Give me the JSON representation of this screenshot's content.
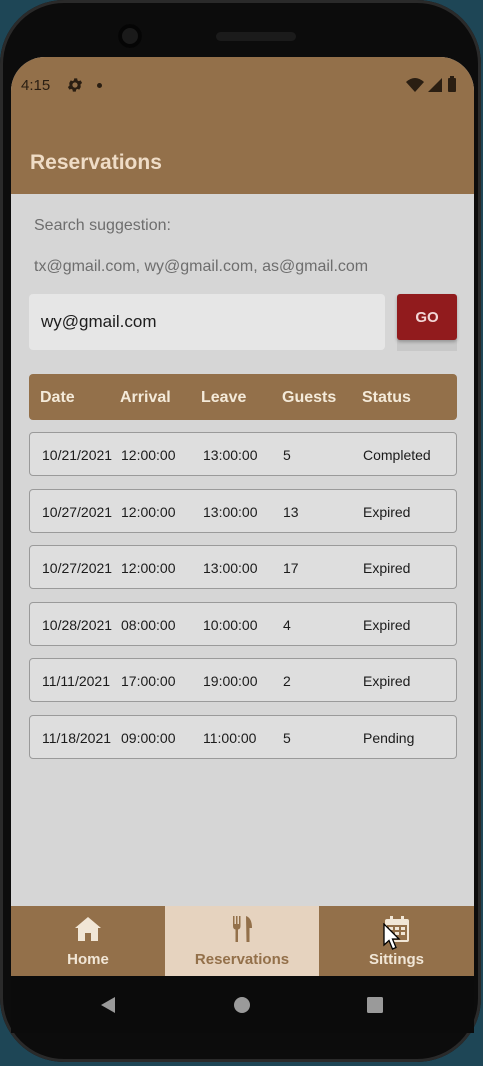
{
  "status_bar": {
    "time": "4:15"
  },
  "app": {
    "title": "Reservations"
  },
  "search": {
    "hint_label": "Search suggestion:",
    "hint_emails": "tx@gmail.com, wy@gmail.com, as@gmail.com",
    "value": "wy@gmail.com",
    "go_label": "GO"
  },
  "table": {
    "headers": {
      "date": "Date",
      "arrival": "Arrival",
      "leave": "Leave",
      "guests": "Guests",
      "status": "Status"
    },
    "rows": [
      {
        "date": "10/21/2021",
        "arrival": "12:00:00",
        "leave": "13:00:00",
        "guests": "5",
        "status": "Completed"
      },
      {
        "date": "10/27/2021",
        "arrival": "12:00:00",
        "leave": "13:00:00",
        "guests": "13",
        "status": "Expired"
      },
      {
        "date": "10/27/2021",
        "arrival": "12:00:00",
        "leave": "13:00:00",
        "guests": "17",
        "status": "Expired"
      },
      {
        "date": "10/28/2021",
        "arrival": "08:00:00",
        "leave": "10:00:00",
        "guests": "4",
        "status": "Expired"
      },
      {
        "date": "11/11/2021",
        "arrival": "17:00:00",
        "leave": "19:00:00",
        "guests": "2",
        "status": "Expired"
      },
      {
        "date": "11/18/2021",
        "arrival": "09:00:00",
        "leave": "11:00:00",
        "guests": "5",
        "status": "Pending"
      }
    ]
  },
  "nav": {
    "items": [
      {
        "label": "Home",
        "icon": "home-icon"
      },
      {
        "label": "Reservations",
        "icon": "fork-knife-icon"
      },
      {
        "label": "Sittings",
        "icon": "calendar-icon"
      }
    ],
    "active": "Reservations"
  },
  "colors": {
    "brand": "#93704a",
    "go_button": "#911b1d",
    "nav_active": "#e6d3bf",
    "background": "#d6d6d6"
  }
}
